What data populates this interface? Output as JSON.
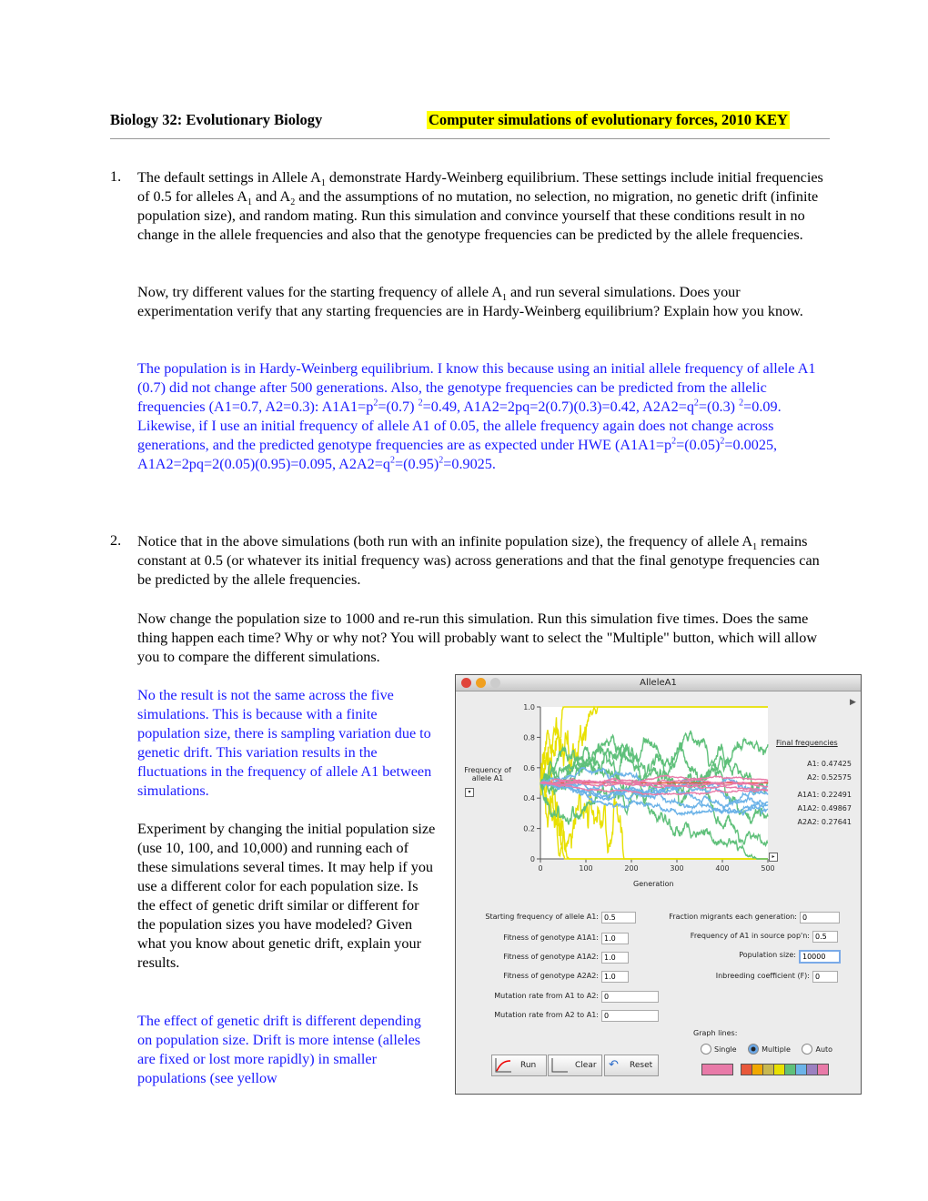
{
  "header": {
    "left": "Biology 32: Evolutionary Biology",
    "right": "Computer simulations of evolutionary forces, 2010 KEY"
  },
  "q1": {
    "number": "1.",
    "p1": [
      [
        "The default settings in Allele A"
      ],
      [
        "1",
        "sub"
      ],
      [
        " demonstrate Hardy-Weinberg equilibrium.  These settings include initial frequencies of 0.5 for alleles A"
      ],
      [
        "1",
        "sub"
      ],
      [
        " and A"
      ],
      [
        "2",
        "sub"
      ],
      [
        " and the assumptions of no mutation, no selection, no migration, no genetic drift (infinite population size), and random mating.  Run this simulation and convince yourself that these conditions result in no change in the allele frequencies and also that the genotype frequencies can be predicted by the allele frequencies."
      ]
    ],
    "p2": [
      [
        "Now, try different values for the starting frequency of allele A"
      ],
      [
        "1",
        "sub"
      ],
      [
        " and run several simulations.  Does your experimentation verify that any starting frequencies are in Hardy-Weinberg equilibrium?  Explain how you know."
      ]
    ],
    "answer": [
      [
        "The population is in Hardy-Weinberg equilibrium.  I know this because using an initial allele frequency of allele A1 (0.7) did not change after 500 generations.  Also, the genotype frequencies can be predicted from the allelic frequencies (A1=0.7, A2=0.3):  A1A1=p"
      ],
      [
        "2",
        "sup"
      ],
      [
        "=(0.7) "
      ],
      [
        "2",
        "sup"
      ],
      [
        "=0.49, A1A2=2pq=2(0.7)(0.3)=0.42, A2A2=q"
      ],
      [
        "2",
        "sup"
      ],
      [
        "=(0.3) "
      ],
      [
        "2",
        "sup"
      ],
      [
        "=0.09.  Likewise, if I use an initial frequency of allele A1 of 0.05, the allele frequency again does not change across generations, and the predicted genotype frequencies are as expected under HWE (A1A1=p"
      ],
      [
        "2",
        "sup"
      ],
      [
        "=(0.05)"
      ],
      [
        "2",
        "sup"
      ],
      [
        "=0.0025, A1A2=2pq=2(0.05)(0.95)=0.095, A2A2=q"
      ],
      [
        "2",
        "sup"
      ],
      [
        "=(0.95)"
      ],
      [
        "2",
        "sup"
      ],
      [
        "=0.9025."
      ]
    ]
  },
  "q2": {
    "number": "2.",
    "p1": [
      [
        "Notice that in the above simulations (both run with an infinite population size), the frequency of allele A"
      ],
      [
        "1",
        "sub"
      ],
      [
        " remains constant at 0.5 (or whatever its initial frequency was) across generations and that the final genotype frequencies can be predicted by the allele frequencies."
      ]
    ],
    "p2": [
      [
        "Now change the population size to 1000 and re-run this simulation.  Run this simulation five times. Does the same thing happen each time?  Why or why not?  You will probably want to select the \"Multiple\" button, which will allow you to compare the different simulations."
      ]
    ],
    "answer1": [
      [
        "No the result is not the same across the five simulations.  This is because with a finite population size, there is sampling variation due to genetic drift.  This variation results in the  fluctuations in the frequency of allele A1 between simulations."
      ]
    ],
    "p3": [
      [
        "Experiment by changing the initial population size (use 10, 100, and 10,000) and running each of these simulations several times.  It may help if you use a different color for each population size.  Is the effect of genetic drift similar or different for the population sizes you have modeled? Given what you know about genetic drift, explain your results."
      ]
    ],
    "answer2": [
      [
        "The effect of genetic drift is different depending on population size.  Drift is more intense (alleles are fixed or lost more rapidly) in smaller populations (see yellow"
      ]
    ]
  },
  "app": {
    "title": "AlleleA1",
    "chart_data": {
      "type": "line",
      "xlabel": "Generation",
      "ylabel": "Frequency of allele A1",
      "xlim": [
        0,
        500
      ],
      "ylim": [
        0,
        1
      ],
      "xticks": [
        "0",
        "100",
        "200",
        "300",
        "400",
        "500"
      ],
      "yticks": [
        "0",
        "0.2",
        "0.4",
        "0.6",
        "0.8",
        "1.0"
      ],
      "series_colors": {
        "N=10": "#e8e000",
        "N=100": "#5fc07a",
        "N=1000": "#6cb3e8",
        "N=10000": "#e87aa8",
        "infinite": "#e8583a"
      }
    },
    "final": {
      "title": "Final frequencies",
      "rows": [
        {
          "k": "A1:",
          "v": "0.47425"
        },
        {
          "k": "A2:",
          "v": "0.52575"
        },
        {
          "k": "A1A1:",
          "v": "0.22491"
        },
        {
          "k": "A1A2:",
          "v": "0.49867"
        },
        {
          "k": "A2A2:",
          "v": "0.27641"
        }
      ]
    },
    "fields": {
      "start_label": "Starting frequency of allele A1:",
      "start": "0.5",
      "fA1A1_label": "Fitness of genotype A1A1:",
      "fA1A1": "1.0",
      "fA1A2_label": "Fitness of genotype A1A2:",
      "fA1A2": "1.0",
      "fA2A2_label": "Fitness of genotype A2A2:",
      "fA2A2": "1.0",
      "mu12_label": "Mutation rate from A1 to A2:",
      "mu12": "0",
      "mu21_label": "Mutation rate from A2 to A1:",
      "mu21": "0",
      "mig_label": "Fraction migrants each generation:",
      "mig": "0",
      "src_label": "Frequency of A1 in source pop'n:",
      "src": "0.5",
      "pop_label": "Population size:",
      "pop": "10000",
      "inb_label": "Inbreeding coefficient (F):",
      "inb": "0"
    },
    "buttons": {
      "run": "Run",
      "clear": "Clear",
      "reset": "Reset"
    },
    "graph_lines": {
      "label": "Graph lines:",
      "single": "Single",
      "multiple": "Multiple",
      "auto": "Auto",
      "selected": "Multiple"
    },
    "colors": {
      "current": "#e87aa8",
      "palette": [
        "#e8583a",
        "#f0a800",
        "#c8b850",
        "#e8e000",
        "#5fc07a",
        "#6cb3e8",
        "#9b80c0",
        "#e87aa8"
      ]
    }
  }
}
